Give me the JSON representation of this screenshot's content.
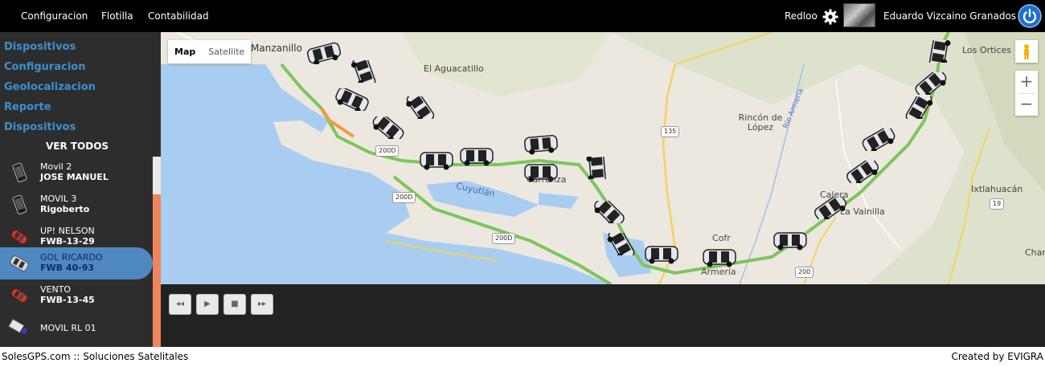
{
  "topbar": {
    "nav": [
      "Configuracion",
      "Flotilla",
      "Contabilidad"
    ],
    "company": "Redloo",
    "user_name": "Eduardo Vizcaino Granados",
    "settings_icon": "gear-icon",
    "logout_icon": "power-icon"
  },
  "sidebar": {
    "menu": [
      "Dispositivos",
      "Configuracion",
      "Geolocalizacion",
      "Reporte",
      "Dispositivos"
    ],
    "ver_todos": "VER TODOS",
    "devices": [
      {
        "name": "Movil 2",
        "plate": "JOSE MANUEL",
        "icon": "phone-icon"
      },
      {
        "name": "MOVIL 3",
        "plate": "Rigoberto",
        "icon": "phone-icon"
      },
      {
        "name": "UP! NELSON",
        "plate": "FWB-13-29",
        "icon": "red-car-icon"
      },
      {
        "name": "GOL RICARDO",
        "plate": "FWB 40-93",
        "icon": "silver-car-icon",
        "selected": true
      },
      {
        "name": "VENTO",
        "plate": "FWB-13-45",
        "icon": "red-car-icon"
      },
      {
        "name": "MOVIL RL 01",
        "plate": "",
        "icon": "truck-icon"
      }
    ]
  },
  "map": {
    "type_buttons": [
      "Map",
      "Satellite"
    ],
    "active_type": "Map",
    "zoom_in": "+",
    "zoom_out": "−",
    "places": [
      "Manzanillo",
      "El Aguacatillo",
      "Los Ortices",
      "Rincón de López",
      "Río Armería",
      "Cuyutlán",
      "Carranza",
      "Calera",
      "La Vainilla",
      "Ixtlahuacán",
      "Cofr",
      "Armería",
      "Chan"
    ],
    "highways": [
      "135",
      "200D",
      "200D",
      "200D",
      "200",
      "19"
    ],
    "colors": {
      "water": "#a9cdf1",
      "land": "#ece8df",
      "hills": "#d6dcc4",
      "highway": "#f4d160",
      "route_green": "#7cc65c",
      "route_orange": "#f39a42"
    }
  },
  "playback": {
    "buttons": [
      "◂◂",
      "▶",
      "■",
      "▸▸"
    ]
  },
  "footer": {
    "left": "SolesGPS.com :: Soluciones Satelitales",
    "right": "Created by EVIGRA"
  }
}
